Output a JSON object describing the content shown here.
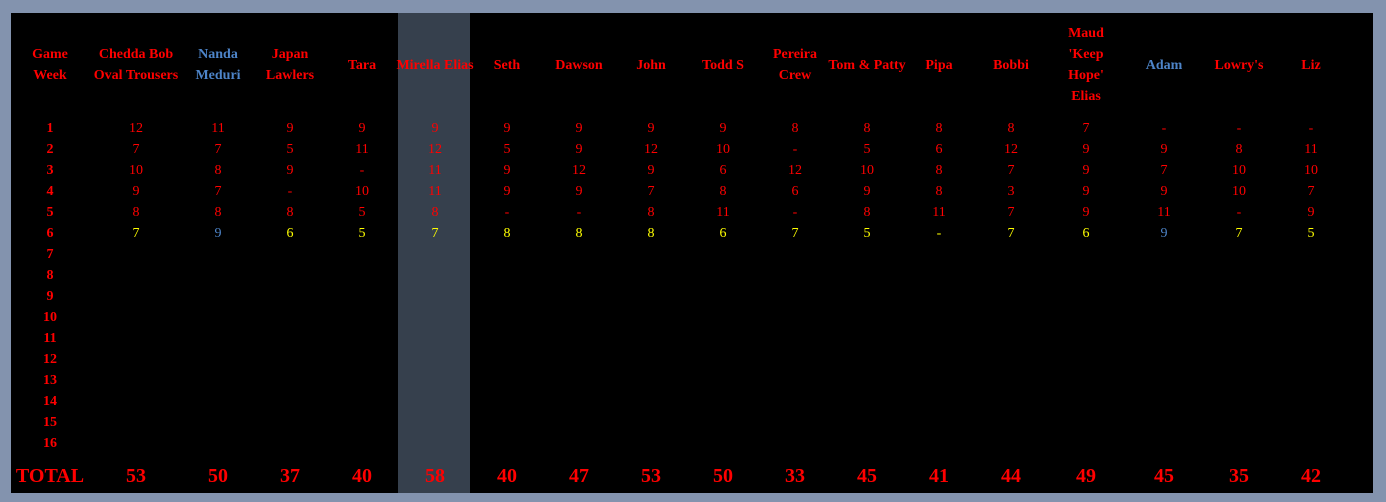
{
  "header": {
    "week_label": "Game Week",
    "players": [
      {
        "name": "Chedda Bob Oval Trousers",
        "color": "red"
      },
      {
        "name": "Nanda Meduri",
        "color": "blue"
      },
      {
        "name": "Japan Lawlers",
        "color": "red"
      },
      {
        "name": "Tara",
        "color": "red"
      },
      {
        "name": "Mirella Elias",
        "color": "red",
        "highlighted": true
      },
      {
        "name": "Seth",
        "color": "red"
      },
      {
        "name": "Dawson",
        "color": "red"
      },
      {
        "name": "John",
        "color": "red"
      },
      {
        "name": "Todd S",
        "color": "red"
      },
      {
        "name": "Pereira Crew",
        "color": "red"
      },
      {
        "name": "Tom & Patty",
        "color": "red"
      },
      {
        "name": "Pipa",
        "color": "red"
      },
      {
        "name": "Bobbi",
        "color": "red"
      },
      {
        "name": "Maud 'Keep Hope' Elias",
        "color": "red"
      },
      {
        "name": "Adam",
        "color": "blue"
      },
      {
        "name": "Lowry's",
        "color": "red"
      },
      {
        "name": "Liz",
        "color": "red"
      }
    ]
  },
  "weeks": [
    {
      "week": "1",
      "scores": [
        "12",
        "11",
        "9",
        "9",
        "9",
        "9",
        "9",
        "9",
        "9",
        "8",
        "8",
        "8",
        "8",
        "7",
        "-",
        "-",
        "-"
      ],
      "colors": "red"
    },
    {
      "week": "2",
      "scores": [
        "7",
        "7",
        "5",
        "11",
        "12",
        "5",
        "9",
        "12",
        "10",
        "-",
        "5",
        "6",
        "12",
        "9",
        "9",
        "8",
        "11"
      ],
      "colors": "red"
    },
    {
      "week": "3",
      "scores": [
        "10",
        "8",
        "9",
        "-",
        "11",
        "9",
        "12",
        "9",
        "6",
        "12",
        "10",
        "8",
        "7",
        "9",
        "7",
        "10",
        "10"
      ],
      "colors": "red"
    },
    {
      "week": "4",
      "scores": [
        "9",
        "7",
        "-",
        "10",
        "11",
        "9",
        "9",
        "7",
        "8",
        "6",
        "9",
        "8",
        "3",
        "9",
        "9",
        "10",
        "7"
      ],
      "colors": "red"
    },
    {
      "week": "5",
      "scores": [
        "8",
        "8",
        "8",
        "5",
        "8",
        "-",
        "-",
        "8",
        "11",
        "-",
        "8",
        "11",
        "7",
        "9",
        "11",
        "-",
        "9"
      ],
      "colors": "red"
    },
    {
      "week": "6",
      "scores": [
        "7",
        "9",
        "6",
        "5",
        "7",
        "8",
        "8",
        "8",
        "6",
        "7",
        "5",
        "-",
        "7",
        "6",
        "9",
        "7",
        "5"
      ],
      "colors": "yellow"
    },
    {
      "week": "7",
      "scores": [],
      "colors": "red"
    },
    {
      "week": "8",
      "scores": [],
      "colors": "red"
    },
    {
      "week": "9",
      "scores": [],
      "colors": "red"
    },
    {
      "week": "10",
      "scores": [],
      "colors": "red"
    },
    {
      "week": "11",
      "scores": [],
      "colors": "red"
    },
    {
      "week": "12",
      "scores": [],
      "colors": "red"
    },
    {
      "week": "13",
      "scores": [],
      "colors": "red"
    },
    {
      "week": "14",
      "scores": [],
      "colors": "red"
    },
    {
      "week": "15",
      "scores": [],
      "colors": "red"
    },
    {
      "week": "16",
      "scores": [],
      "colors": "red"
    }
  ],
  "week6_colors": [
    "yellow",
    "blue",
    "yellow",
    "yellow",
    "yellow",
    "yellow",
    "yellow",
    "yellow",
    "yellow",
    "yellow",
    "yellow",
    "yellow",
    "yellow",
    "yellow",
    "blue",
    "yellow",
    "yellow"
  ],
  "totals": {
    "label": "TOTAL",
    "values": [
      "53",
      "50",
      "37",
      "40",
      "58",
      "40",
      "47",
      "53",
      "50",
      "33",
      "45",
      "41",
      "44",
      "49",
      "45",
      "35",
      "42"
    ]
  },
  "colors": {
    "background": "#8393ae",
    "board": "#000000",
    "highlight_column": "#36404d",
    "red": "#ff0000",
    "yellow": "#ffff00",
    "blue": "#4d84c8"
  }
}
